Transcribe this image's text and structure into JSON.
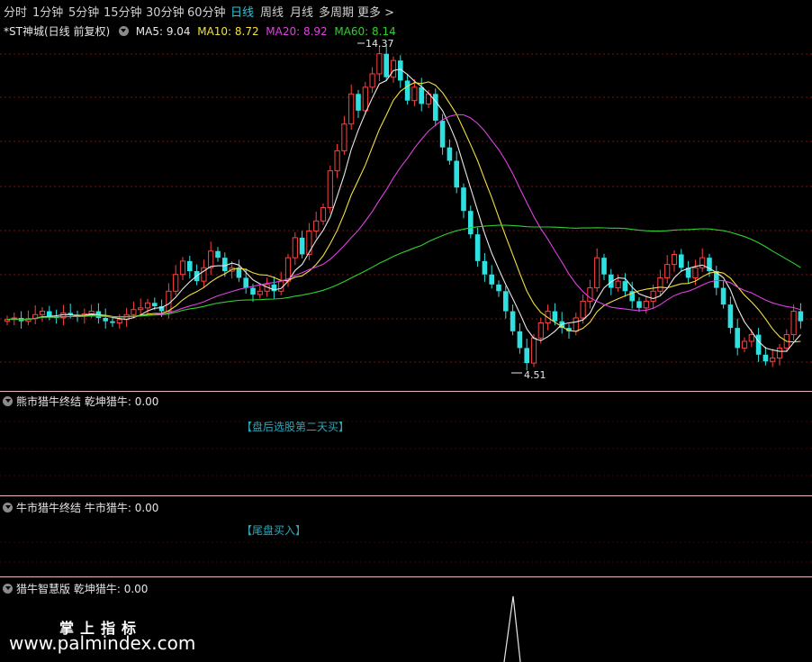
{
  "tabs": [
    "分时",
    "1分钟",
    "5分钟",
    "15分钟",
    "30分钟",
    "60分钟",
    "日线",
    "周线",
    "月线",
    "多周期",
    "更多"
  ],
  "active_tab": "日线",
  "main": {
    "title": "*ST神城(日线 前复权)",
    "ma": [
      {
        "label": "MA5: 9.04",
        "color": "#e8e8e8"
      },
      {
        "label": "MA10: 8.72",
        "color": "#f0e040"
      },
      {
        "label": "MA20: 8.92",
        "color": "#e040e0"
      },
      {
        "label": "MA60: 8.14",
        "color": "#30d030"
      }
    ],
    "high_label": "14.37",
    "low_label": "4.51"
  },
  "panels": [
    {
      "title": "熊市猎牛终结",
      "value": "乾坤猎牛: 0.00",
      "signal": "【盘后选股第二天买】"
    },
    {
      "title": "牛市猎牛终结",
      "value": "牛市猎牛: 0.00",
      "signal": "【尾盘买入】"
    },
    {
      "title": "猎牛智慧版",
      "value": "乾坤猎牛: 0.00"
    }
  ],
  "watermark": {
    "line1": "掌上指标",
    "line2": "www.palmindex.com"
  },
  "colors": {
    "up": "#ff4040",
    "down": "#2ee0e0",
    "ma5": "#e8e8e8",
    "ma10": "#f0e040",
    "ma20": "#e040e0",
    "ma60": "#30d030",
    "grid": "#7a1010"
  },
  "chart_data": {
    "type": "candlestick",
    "price_range": [
      4.0,
      15.0
    ],
    "closes": [
      6.05,
      6.1,
      6.0,
      6.08,
      6.2,
      6.3,
      6.15,
      6.1,
      6.25,
      6.2,
      6.15,
      6.22,
      6.3,
      6.1,
      6.0,
      5.95,
      6.05,
      6.2,
      6.35,
      6.4,
      6.55,
      6.45,
      6.3,
      6.9,
      7.4,
      7.8,
      7.5,
      7.2,
      7.6,
      8.1,
      7.9,
      7.5,
      7.6,
      7.3,
      7.0,
      6.8,
      6.9,
      7.1,
      6.9,
      7.2,
      7.9,
      8.5,
      8.0,
      8.7,
      9.0,
      9.4,
      10.5,
      11.1,
      11.9,
      12.8,
      12.3,
      13.0,
      13.4,
      14.0,
      13.3,
      13.8,
      13.2,
      12.6,
      13.0,
      12.5,
      12.8,
      12.0,
      11.2,
      10.8,
      10.0,
      9.3,
      8.6,
      7.8,
      7.4,
      7.1,
      6.9,
      6.3,
      5.7,
      5.2,
      4.75,
      5.5,
      5.95,
      6.3,
      6.0,
      5.8,
      5.7,
      6.1,
      6.6,
      7.0,
      7.9,
      7.4,
      7.0,
      7.2,
      6.9,
      6.6,
      6.4,
      6.6,
      6.9,
      7.3,
      7.7,
      8.0,
      7.6,
      7.3,
      7.6,
      7.9,
      7.5,
      7.0,
      6.5,
      5.8,
      5.2,
      5.4,
      5.6,
      5.0,
      4.8,
      4.9,
      5.2,
      5.6,
      6.3,
      6.0
    ]
  }
}
